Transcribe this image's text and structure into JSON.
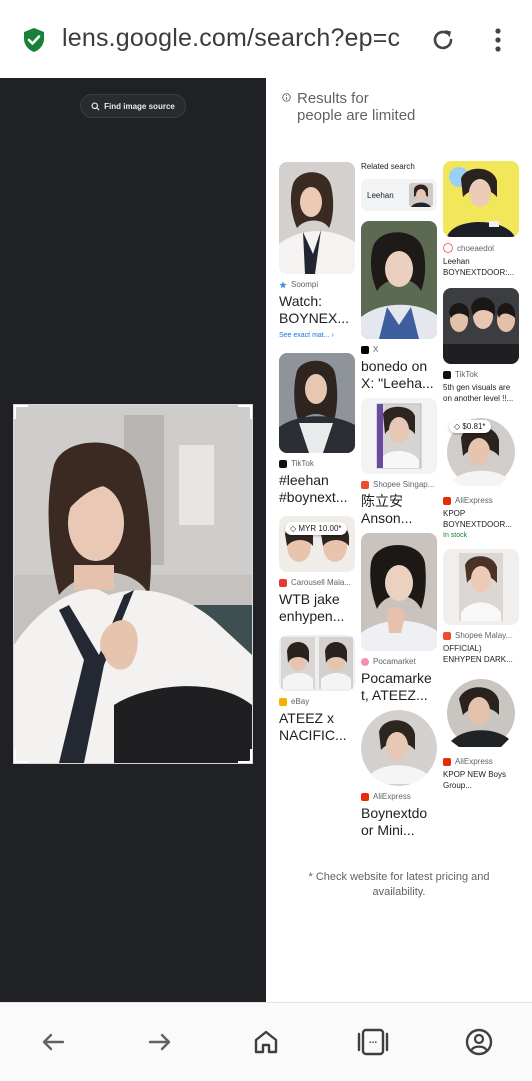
{
  "browser": {
    "url": "lens.google.com/search?ep=c",
    "reload_icon": "reload-icon",
    "menu_icon": "more-vert-icon",
    "security_icon": "shield-check-icon"
  },
  "left_pane": {
    "find_source_label": "Find image source"
  },
  "results": {
    "limited_notice": "Results for people are limited",
    "related_label": "Related search",
    "related_chip": "Leehan",
    "col1": [
      {
        "source": "Soompi",
        "title": "Watch: BOYNEX...",
        "exact": "See exact mat..."
      },
      {
        "source": "TikTok",
        "title": "#leehan #boynext..."
      },
      {
        "source": "Carousell Mala...",
        "title": "WTB jake enhypen...",
        "price": "MYR 10.00*"
      },
      {
        "source": "eBay",
        "title": "ATEEZ x NACIFIC..."
      }
    ],
    "col2": [
      {
        "source": "X",
        "title": "bonedo on X: \"Leeha..."
      },
      {
        "source": "Shopee Singap...",
        "title": "陈立安 Anson..."
      },
      {
        "source": "Pocamarket",
        "title": "Pocamarke t, ATEEZ..."
      },
      {
        "source": "AliExpress",
        "title": "Boynextdo or Mini..."
      }
    ],
    "col3": [
      {
        "source": "choeaedol",
        "title": "Leehan BOYNEXTDOOR:..."
      },
      {
        "source": "TikTok",
        "title": "5th gen visuals are on another level !!..."
      },
      {
        "source": "AliExpress",
        "title": "KPOP BOYNEXTDOOR...",
        "price": "$0.81*",
        "stock": "In stock"
      },
      {
        "source": "Shopee Malay...",
        "title": "OFFICIAL) ENHYPEN DARK..."
      },
      {
        "source": "AliExpress",
        "title": "KPOP NEW Boys Group..."
      }
    ],
    "footnote": "* Check website for latest pricing and availability."
  },
  "navigation": {
    "back": "arrow-back-icon",
    "forward": "arrow-forward-icon",
    "home": "home-icon",
    "tabs": "tabs-icon",
    "tabs_count": "...",
    "account": "account-icon"
  },
  "colors": {
    "secure_green": "#188038",
    "dark_pane": "#202124",
    "link_blue": "#1a73e8"
  }
}
